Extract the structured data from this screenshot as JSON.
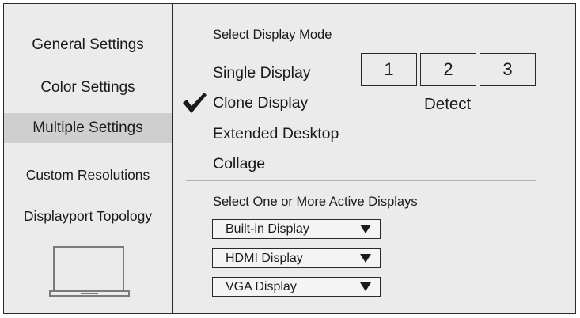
{
  "sidebar": {
    "items": [
      {
        "label": "General Settings"
      },
      {
        "label": "Color Settings"
      },
      {
        "label": "Multiple Settings"
      },
      {
        "label": "Custom Resolutions"
      },
      {
        "label": "Displayport Topology"
      }
    ],
    "active_item": "Multiple Settings",
    "footer_icon": "laptop-icon"
  },
  "display_mode": {
    "title": "Select Display Mode",
    "options": [
      {
        "label": "Single Display",
        "selected": false
      },
      {
        "label": "Clone Display",
        "selected": true
      },
      {
        "label": "Extended Desktop",
        "selected": false
      },
      {
        "label": "Collage",
        "selected": false
      }
    ],
    "selected_icon": "checkmark-icon"
  },
  "display_buttons": [
    "1",
    "2",
    "3"
  ],
  "detect_label": "Detect",
  "active_displays": {
    "title": "Select One or More Active Displays",
    "dropdowns": [
      {
        "value": "Built-in Display"
      },
      {
        "value": "HDMI Display"
      },
      {
        "value": "VGA Display"
      }
    ],
    "arrow_icon": "triangle-down-icon"
  },
  "colors": {
    "panel_background": "#ebebeb",
    "active_item_background": "#cfcfcf",
    "border": "#2a2a2a",
    "divider": "#b3b3b3"
  }
}
